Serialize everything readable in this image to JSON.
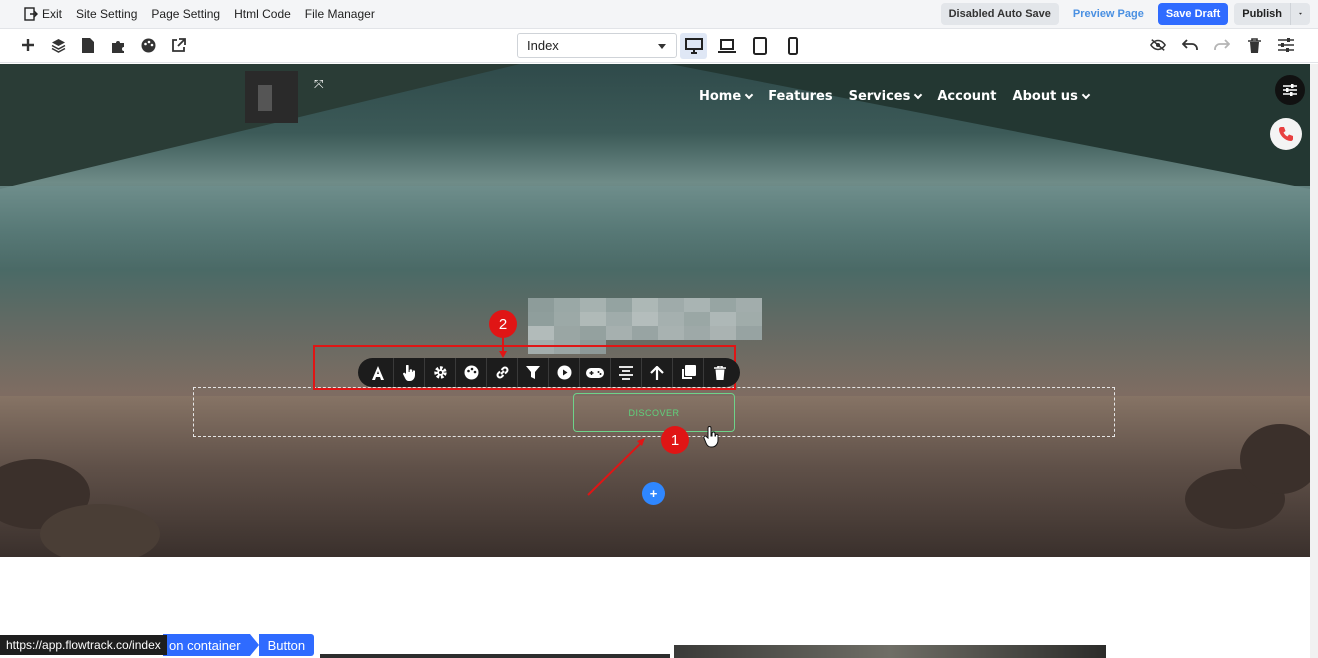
{
  "topbar": {
    "exit_label": "Exit",
    "site_setting_label": "Site Setting",
    "page_setting_label": "Page Setting",
    "html_code_label": "Html Code",
    "file_manager_label": "File Manager",
    "auto_save_label": "Disabled Auto Save",
    "preview_label": "Preview Page",
    "save_draft_label": "Save Draft",
    "publish_label": "Publish"
  },
  "toolbar": {
    "page_select_value": "Index",
    "active_device": "desktop"
  },
  "site": {
    "nav": [
      {
        "label": "Home",
        "dropdown": true
      },
      {
        "label": "Features",
        "dropdown": false
      },
      {
        "label": "Services",
        "dropdown": true
      },
      {
        "label": "Account",
        "dropdown": false
      },
      {
        "label": "About us",
        "dropdown": true
      }
    ],
    "button_label": "DISCOVER"
  },
  "element_toolbar": {
    "tools": [
      "text-icon",
      "hand-pointer-icon",
      "gear-icon",
      "palette-icon",
      "link-icon",
      "filter-icon",
      "play-icon",
      "gamepad-icon",
      "align-center-icon",
      "arrow-up-icon",
      "duplicate-icon",
      "trash-icon"
    ]
  },
  "annotations": {
    "badge_1": "1",
    "badge_2": "2"
  },
  "status_bar": {
    "url": "https://app.flowtrack.co/index"
  },
  "breadcrumb": {
    "items": [
      "on container",
      "Button"
    ]
  },
  "colors": {
    "accent": "#2f6bff",
    "annotation": "#e01515",
    "button_border": "#6ed38a"
  }
}
